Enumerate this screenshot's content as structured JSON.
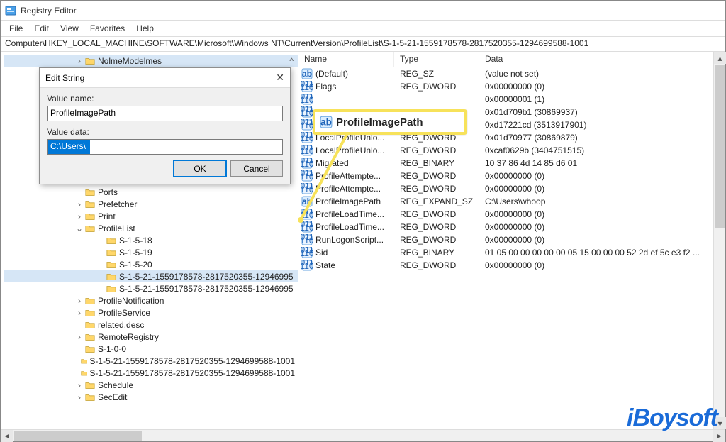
{
  "window": {
    "title": "Registry Editor"
  },
  "menu": {
    "file": "File",
    "edit": "Edit",
    "view": "View",
    "favorites": "Favorites",
    "help": "Help"
  },
  "address": "Computer\\HKEY_LOCAL_MACHINE\\SOFTWARE\\Microsoft\\Windows NT\\CurrentVersion\\ProfileList\\S-1-5-21-1559178578-2817520355-1294699588-1001",
  "tree": {
    "top_selected": "NolmeModelmes",
    "items": [
      "Ports",
      "Prefetcher",
      "Print",
      "ProfileList",
      "S-1-5-18",
      "S-1-5-19",
      "S-1-5-20",
      "S-1-5-21-1559178578-2817520355-12946995",
      "S-1-5-21-1559178578-2817520355-12946995",
      "ProfileNotification",
      "ProfileService",
      "related.desc",
      "RemoteRegistry",
      "S-1-0-0",
      "S-1-5-21-1559178578-2817520355-1294699588-1001",
      "S-1-5-21-1559178578-2817520355-1294699588-1001",
      "Schedule",
      "SecEdit"
    ]
  },
  "columns": {
    "name": "Name",
    "type": "Type",
    "data": "Data"
  },
  "values": [
    {
      "name": "(Default)",
      "type": "REG_SZ",
      "data": "(value not set)",
      "icon": "sz"
    },
    {
      "name": "Flags",
      "type": "REG_DWORD",
      "data": "0x00000000 (0)",
      "icon": "bin"
    },
    {
      "name": "",
      "type": "",
      "data": "0x00000001 (1)",
      "icon": "bin"
    },
    {
      "name": "",
      "type": "",
      "data": "0x01d709b1 (30869937)",
      "icon": "bin"
    },
    {
      "name": "",
      "type": "",
      "data": "0xd17221cd (3513917901)",
      "icon": "bin"
    },
    {
      "name": "LocalProfileUnlo...",
      "type": "REG_DWORD",
      "data": "0x01d70977 (30869879)",
      "icon": "bin"
    },
    {
      "name": "LocalProfileUnlo...",
      "type": "REG_DWORD",
      "data": "0xcaf0629b (3404751515)",
      "icon": "bin"
    },
    {
      "name": "Migrated",
      "type": "REG_BINARY",
      "data": "10 37 86 4d 14 85 d6 01",
      "icon": "bin"
    },
    {
      "name": "ProfileAttempte...",
      "type": "REG_DWORD",
      "data": "0x00000000 (0)",
      "icon": "bin"
    },
    {
      "name": "ProfileAttempte...",
      "type": "REG_DWORD",
      "data": "0x00000000 (0)",
      "icon": "bin"
    },
    {
      "name": "ProfileImagePath",
      "type": "REG_EXPAND_SZ",
      "data": "C:\\Users\\whoop",
      "icon": "sz"
    },
    {
      "name": "ProfileLoadTime...",
      "type": "REG_DWORD",
      "data": "0x00000000 (0)",
      "icon": "bin"
    },
    {
      "name": "ProfileLoadTime...",
      "type": "REG_DWORD",
      "data": "0x00000000 (0)",
      "icon": "bin"
    },
    {
      "name": "RunLogonScript...",
      "type": "REG_DWORD",
      "data": "0x00000000 (0)",
      "icon": "bin"
    },
    {
      "name": "Sid",
      "type": "REG_BINARY",
      "data": "01 05 00 00 00 00 00 05 15 00 00 00 52 2d ef 5c e3 f2 ...",
      "icon": "bin"
    },
    {
      "name": "State",
      "type": "REG_DWORD",
      "data": "0x00000000 (0)",
      "icon": "bin"
    }
  ],
  "dialog": {
    "title": "Edit String",
    "value_name_label": "Value name:",
    "value_name": "ProfileImagePath",
    "value_data_label": "Value data:",
    "value_data": "C:\\Users\\",
    "ok": "OK",
    "cancel": "Cancel"
  },
  "callout_label": "ProfileImagePath",
  "watermark": "iBoysoft"
}
